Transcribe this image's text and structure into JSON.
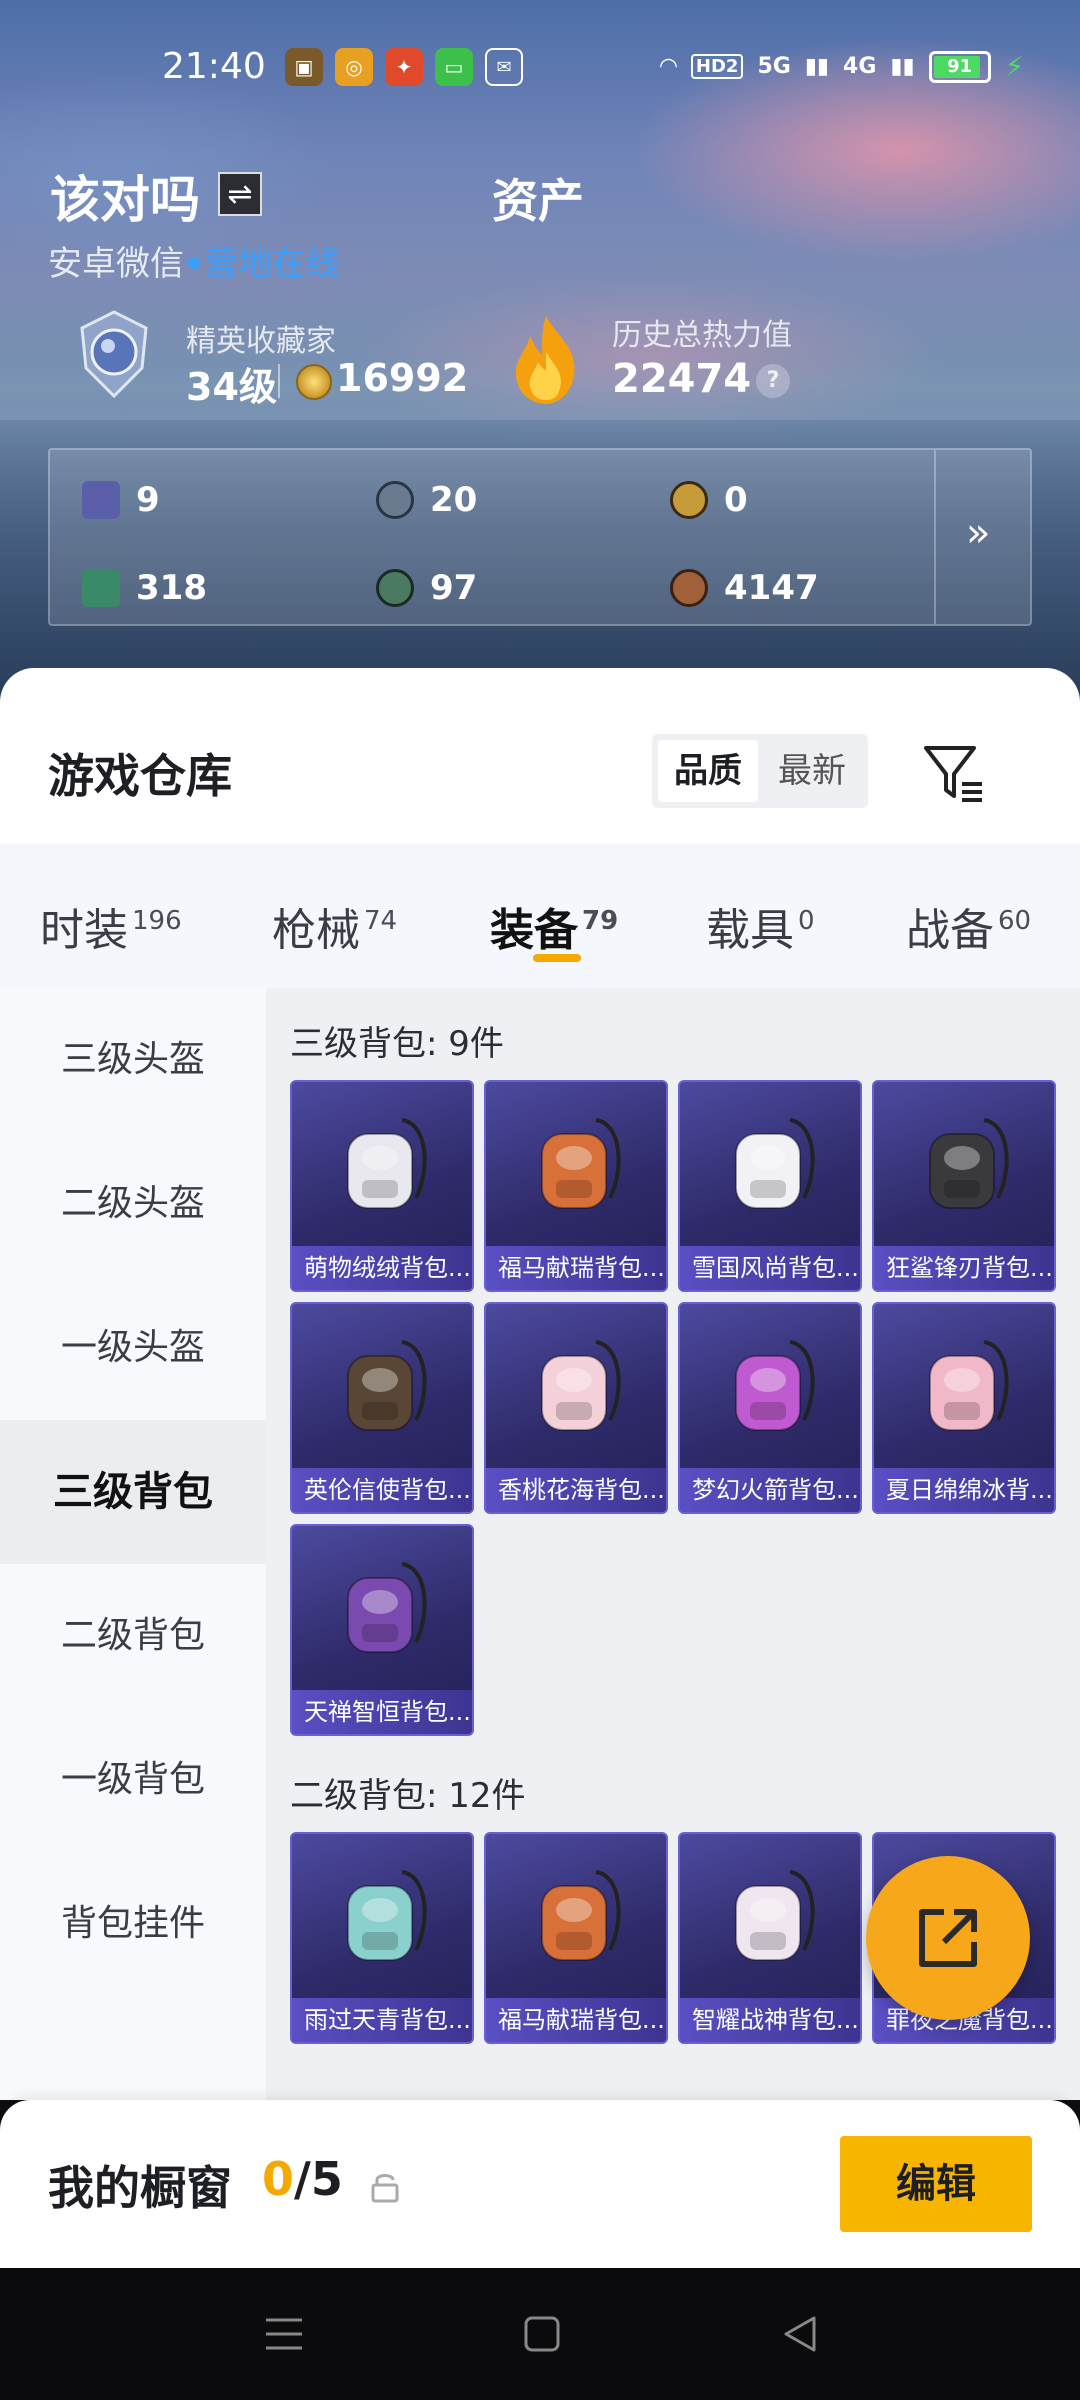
{
  "status_bar": {
    "time": "21:40",
    "battery": "91",
    "signal1": "5G",
    "signal2": "4G",
    "hd": "HD2"
  },
  "header": {
    "username": "该对吗",
    "title": "资产",
    "platform": "安卓微信",
    "online_status": "营地在线",
    "rank_title": "精英收藏家",
    "rank_level": "34级",
    "rank_coins": "16992",
    "heat_title": "历史总热力值",
    "heat_value": "22474"
  },
  "assets": [
    {
      "icon": "purple-card-icon",
      "value": "9",
      "color": "#5b5ea8"
    },
    {
      "icon": "silver-coin-icon",
      "value": "20",
      "color": "#6a7a8f"
    },
    {
      "icon": "gold-coin-icon",
      "value": "0",
      "color": "#c79a3a"
    },
    {
      "icon": "green-card-icon",
      "value": "318",
      "color": "#3a8a6a"
    },
    {
      "icon": "green-coin-icon",
      "value": "97",
      "color": "#4a7a62"
    },
    {
      "icon": "bronze-coin-icon",
      "value": "4147",
      "color": "#a0603a"
    }
  ],
  "warehouse": {
    "title": "游戏仓库",
    "sort_quality": "品质",
    "sort_newest": "最新"
  },
  "tabs": [
    {
      "label": "时装",
      "count": "196"
    },
    {
      "label": "枪械",
      "count": "74"
    },
    {
      "label": "装备",
      "count": "79"
    },
    {
      "label": "载具",
      "count": "0"
    },
    {
      "label": "战备",
      "count": "60"
    }
  ],
  "sidebar": [
    "三级头盔",
    "二级头盔",
    "一级头盔",
    "三级背包",
    "二级背包",
    "一级背包",
    "背包挂件"
  ],
  "sections": [
    {
      "title": "三级背包: 9件",
      "items": [
        {
          "name": "萌物绒绒背包...",
          "color": "#e8e8ee"
        },
        {
          "name": "福马献瑞背包...",
          "color": "#d8703a"
        },
        {
          "name": "雪国风尚背包...",
          "color": "#f2f2f6"
        },
        {
          "name": "狂鲨锋刃背包...",
          "color": "#3a3a3e"
        },
        {
          "name": "英伦信使背包...",
          "color": "#5a4634"
        },
        {
          "name": "香桃花海背包...",
          "color": "#f4d0d8"
        },
        {
          "name": "梦幻火箭背包...",
          "color": "#c05ad0"
        },
        {
          "name": "夏日绵绵冰背...",
          "color": "#f0b8c8"
        },
        {
          "name": "天禅智恒背包...",
          "color": "#7a4ab0"
        }
      ]
    },
    {
      "title": "二级背包: 12件",
      "items": [
        {
          "name": "雨过天青背包...",
          "color": "#8ad0cc"
        },
        {
          "name": "福马献瑞背包...",
          "color": "#d8703a"
        },
        {
          "name": "智耀战神背包...",
          "color": "#f0e6f0"
        },
        {
          "name": "罪夜之魔背包...",
          "color": "#3a3050"
        }
      ]
    }
  ],
  "showcase": {
    "title": "我的橱窗",
    "current": "0",
    "total": "/5",
    "edit_label": "编辑"
  }
}
